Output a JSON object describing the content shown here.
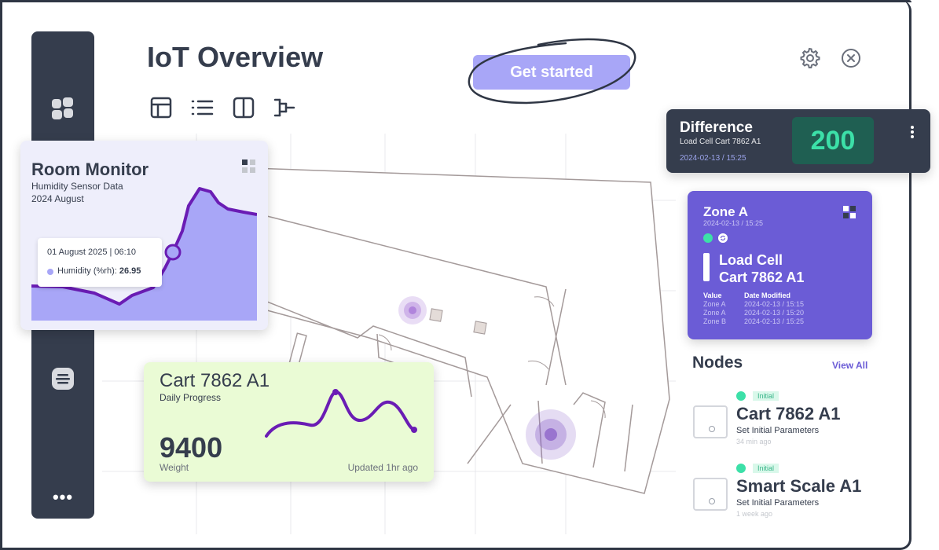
{
  "app": {
    "title": "IoT Overview"
  },
  "header": {
    "cta_label": "Get started"
  },
  "sidebar": {
    "more_label": "•••"
  },
  "toolbar": {
    "icons": [
      "table-icon",
      "list-icon",
      "columns-icon",
      "tree-icon"
    ]
  },
  "top_icons": [
    "gear-icon",
    "close-icon"
  ],
  "room_monitor": {
    "title": "Room Monitor",
    "subtitle": "Humidity Sensor Data",
    "date": "2024 August",
    "tooltip_date": "01 August 2025 | 06:10",
    "tooltip_label": "Humidity (%rh):",
    "tooltip_value": "26.95"
  },
  "cart_progress": {
    "title": "Cart 7862 A1",
    "subtitle": "Daily Progress",
    "value": "9400",
    "value_label": "Weight",
    "updated": "Updated 1hr ago"
  },
  "difference": {
    "title": "Difference",
    "subtitle": "Load Cell Cart 7862 A1",
    "date": "2024-02-13 / 15:25",
    "value": "200"
  },
  "zone": {
    "title": "Zone A",
    "date": "2024-02-13 / 15:25",
    "heading_line1": "Load Cell",
    "heading_line2": "Cart 7862 A1",
    "col_value": "Value",
    "col_date": "Date Modified",
    "rows": [
      {
        "value": "Zone A",
        "date": "2024-02-13 / 15:15"
      },
      {
        "value": "Zone A",
        "date": "2024-02-13 / 15:20"
      },
      {
        "value": "Zone B",
        "date": "2024-02-13 / 15:25"
      }
    ]
  },
  "nodes": {
    "title": "Nodes",
    "view_all": "View All",
    "items": [
      {
        "status": "Initial",
        "name": "Cart 7862 A1",
        "desc": "Set Initial Parameters",
        "time": "34 min ago"
      },
      {
        "status": "Initial",
        "name": "Smart Scale A1",
        "desc": "Set Initial Parameters",
        "time": "1 week ago"
      }
    ]
  },
  "colors": {
    "dark": "#353d4d",
    "accent_purple": "#6b5cd6",
    "light_purple": "#a8a6f7",
    "green": "#3ce0a8",
    "lime_bg": "#eafbd5"
  }
}
